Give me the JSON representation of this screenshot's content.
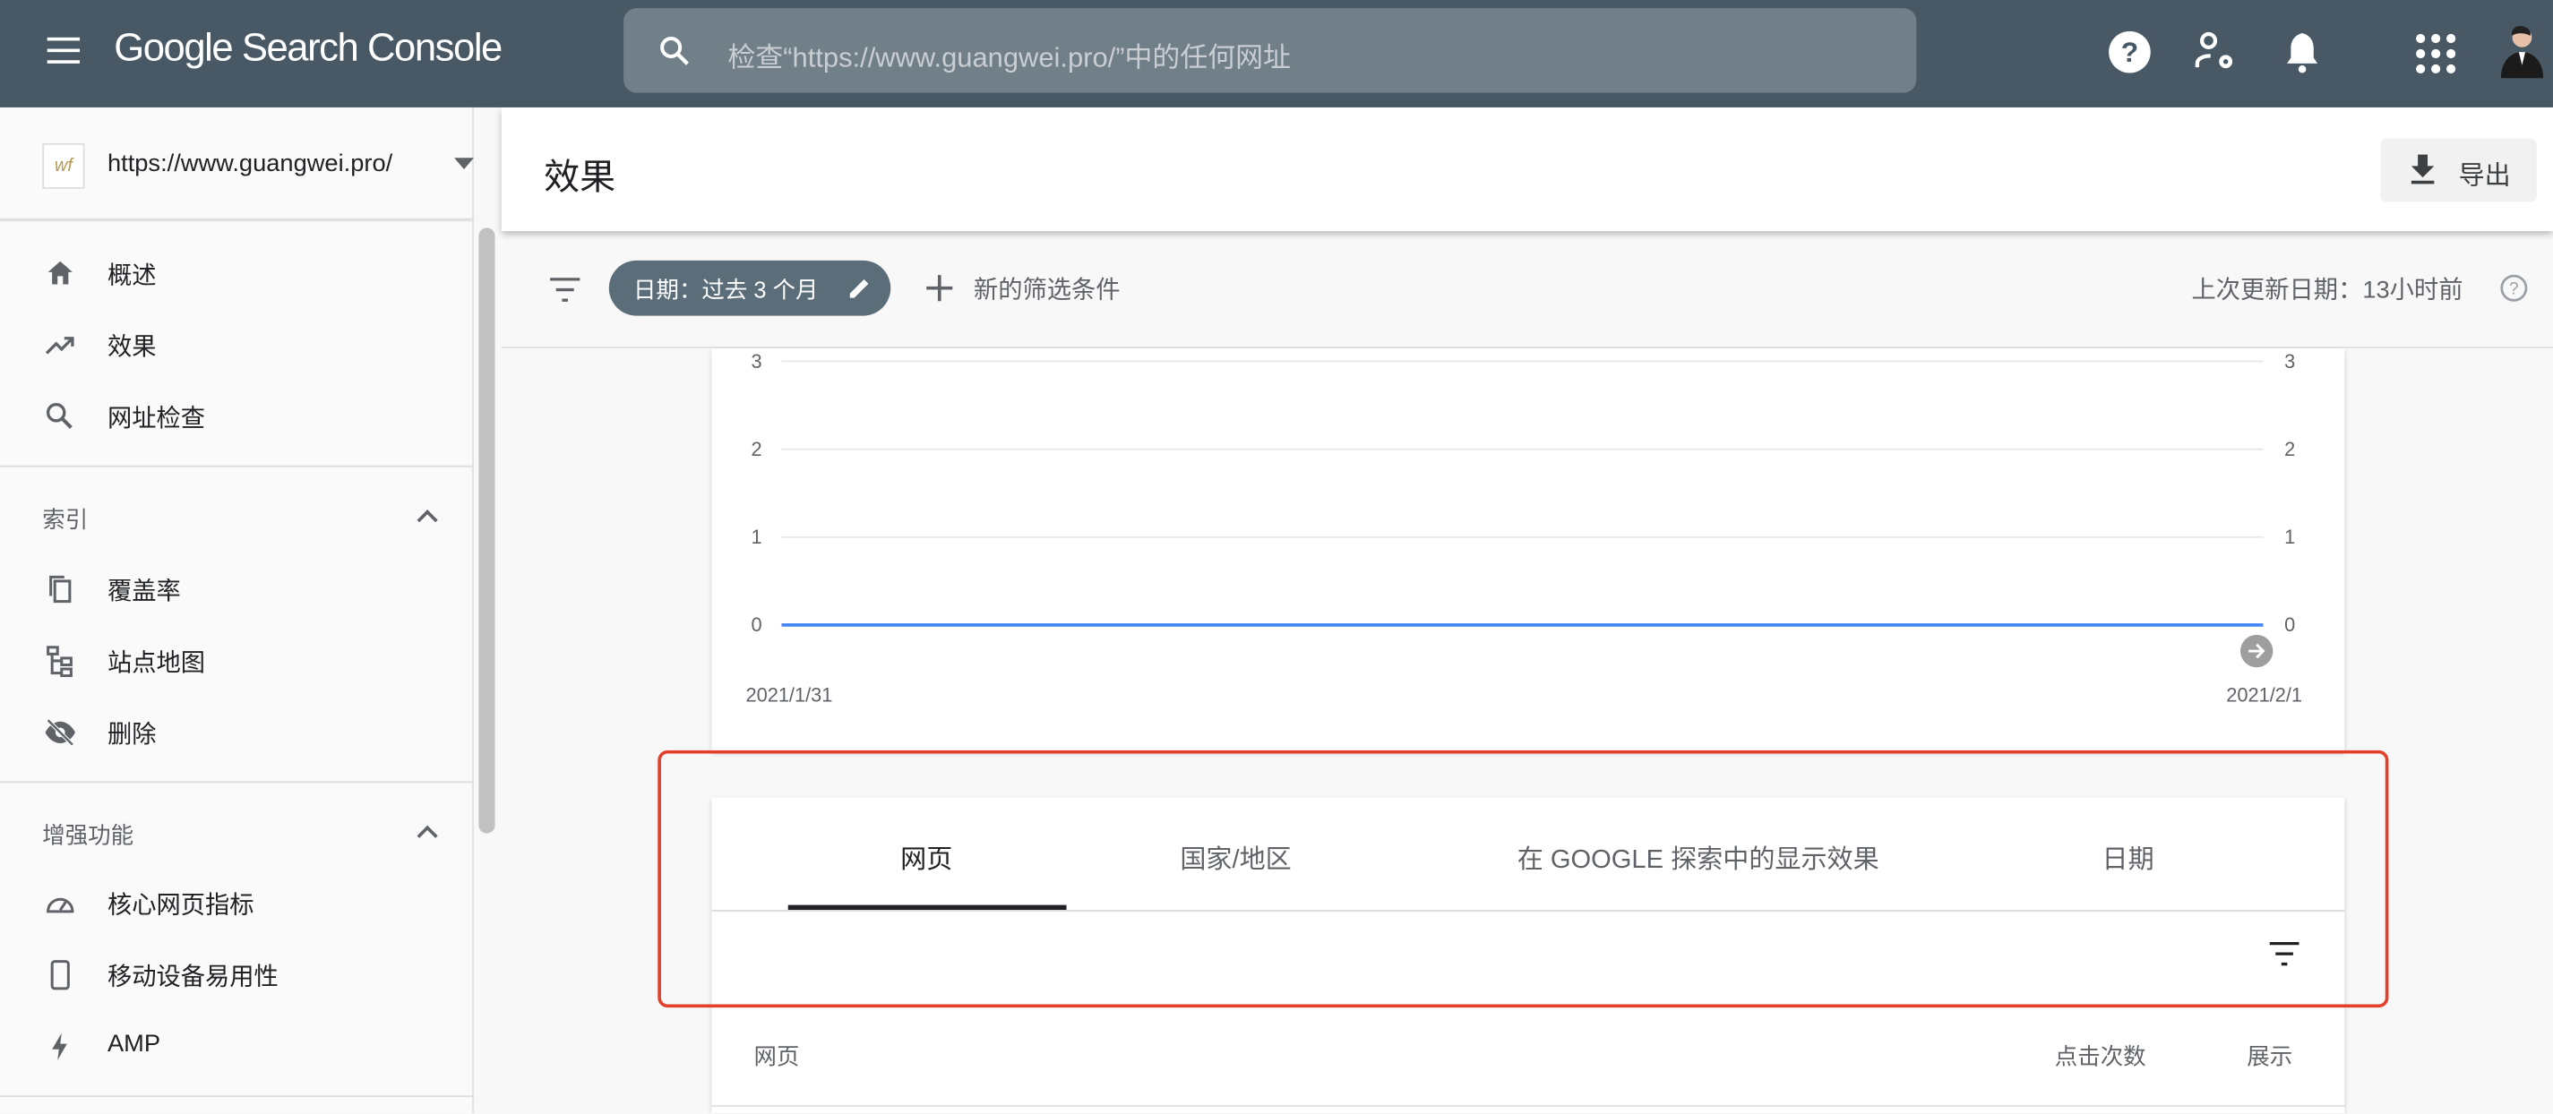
{
  "topbar": {
    "title": "Google Search Console",
    "search_placeholder": "检查“https://www.guangwei.pro/”中的任何网址",
    "icons": [
      "menu-icon",
      "help-icon",
      "user-settings-icon",
      "bell-icon",
      "apps-icon",
      "avatar"
    ]
  },
  "sidebar": {
    "property": "https://www.guangwei.pro/",
    "property_logo": "wf",
    "items": [
      {
        "label": "概述",
        "icon": "home-icon"
      },
      {
        "label": "效果",
        "icon": "trending-icon"
      },
      {
        "label": "网址检查",
        "icon": "search-icon"
      }
    ],
    "sections": [
      {
        "label": "索引",
        "items": [
          {
            "label": "覆盖率",
            "icon": "copy-icon"
          },
          {
            "label": "站点地图",
            "icon": "sitemap-icon"
          },
          {
            "label": "删除",
            "icon": "eye-off-icon"
          }
        ]
      },
      {
        "label": "增强功能",
        "items": [
          {
            "label": "核心网页指标",
            "icon": "gauge-icon"
          },
          {
            "label": "移动设备易用性",
            "icon": "phone-icon"
          },
          {
            "label": "AMP",
            "icon": "bolt-icon"
          }
        ]
      }
    ]
  },
  "header": {
    "title": "效果",
    "export_label": "导出"
  },
  "filters": {
    "date_chip": "日期：过去 3 个月",
    "new_filter": "新的筛选条件",
    "last_updated": "上次更新日期：13小时前"
  },
  "chart_data": {
    "type": "line",
    "x": [
      "2021/1/31",
      "2021/2/1"
    ],
    "series": [
      {
        "color": "#4285f4",
        "values": [
          0,
          0
        ]
      }
    ],
    "x_tick_labels": [
      "2021/1/31",
      "2021/2/1"
    ],
    "y_ticks": [
      "0",
      "1",
      "2",
      "3"
    ],
    "ylim": [
      0,
      3
    ],
    "grid": true
  },
  "tabs": {
    "items": [
      "网页",
      "国家/地区",
      "在 GOOGLE 探索中的显示效果",
      "日期"
    ],
    "active": 0
  },
  "table": {
    "columns": [
      "网页",
      "点击次数",
      "展示"
    ]
  },
  "colors": {
    "topbar": "#485965",
    "chip": "#5b6d79",
    "line": "#4285f4",
    "highlight": "#e3402c"
  }
}
